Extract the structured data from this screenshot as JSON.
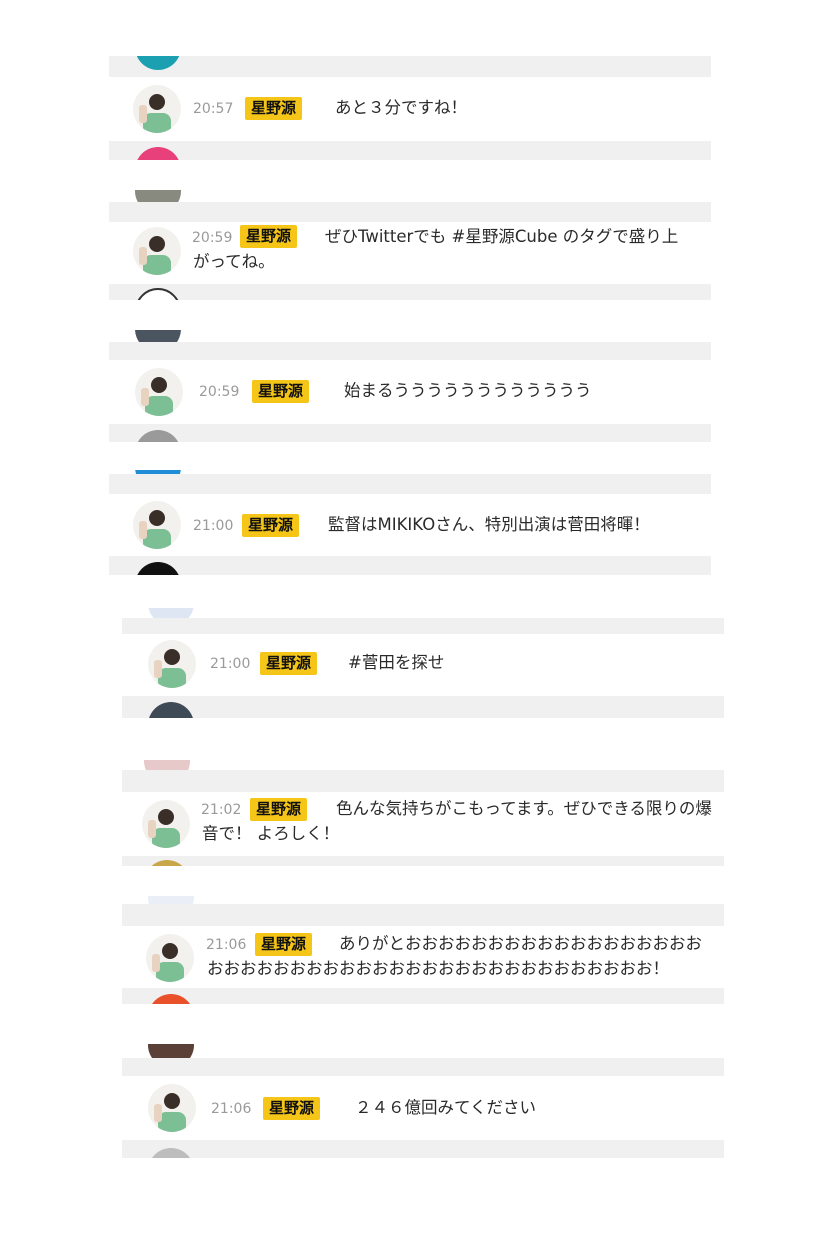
{
  "app": {
    "username": "星野源"
  },
  "comments": [
    {
      "time": "20:57",
      "user": "星野源",
      "text": "あと３分ですね！"
    },
    {
      "time": "20:59",
      "user": "星野源",
      "text": "ぜひTwitterでも #星野源Cube のタグで盛り上がってね。"
    },
    {
      "time": "20:59",
      "user": "星野源",
      "text": "始まるうううううううううううう"
    },
    {
      "time": "21:00",
      "user": "星野源",
      "text": "監督はMIKIKOさん、特別出演は菅田将暉！"
    },
    {
      "time": "21:00",
      "user": "星野源",
      "text": "#菅田を探せ"
    },
    {
      "time": "21:02",
      "user": "星野源",
      "text": "色んな気持ちがこもってます。ぜひできる限りの爆音で！ よろしく！"
    },
    {
      "time": "21:06",
      "user": "星野源",
      "text": "ありがとおおおおおおおおおおおおおおおおおおおおおおおおおおおおおおおおおおおおおおおおおおおおお！"
    },
    {
      "time": "21:06",
      "user": "星野源",
      "text": "２４６億回みてください"
    }
  ],
  "colors": {
    "badge": "#f5c518",
    "divider": "#f0f0f0"
  }
}
